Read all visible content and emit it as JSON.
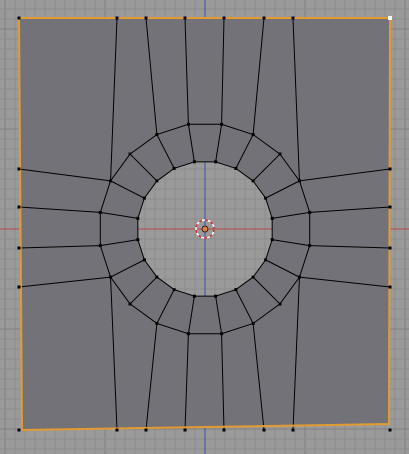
{
  "viewport": {
    "view": "top-orthographic-edit-mode",
    "background_color": "#9a9a9a",
    "grid_minor_color": "#8c8c8c",
    "grid_major_color": "#808080",
    "axis_x_color": "#b04a4a",
    "axis_y_color": "#3f4fb0",
    "mesh_face_color": "#737278",
    "mesh_edge_color": "#000000",
    "mesh_vertex_color": "#000000",
    "selected_edge_color": "#e29b33",
    "selected_vertex_color": "#ffffff",
    "cursor": {
      "icon": "3d-cursor-icon",
      "ring_colors": [
        "#cc2a2a",
        "#ffffff"
      ]
    },
    "object_origin": {
      "icon": "object-origin-icon",
      "color": "#e08040"
    }
  }
}
